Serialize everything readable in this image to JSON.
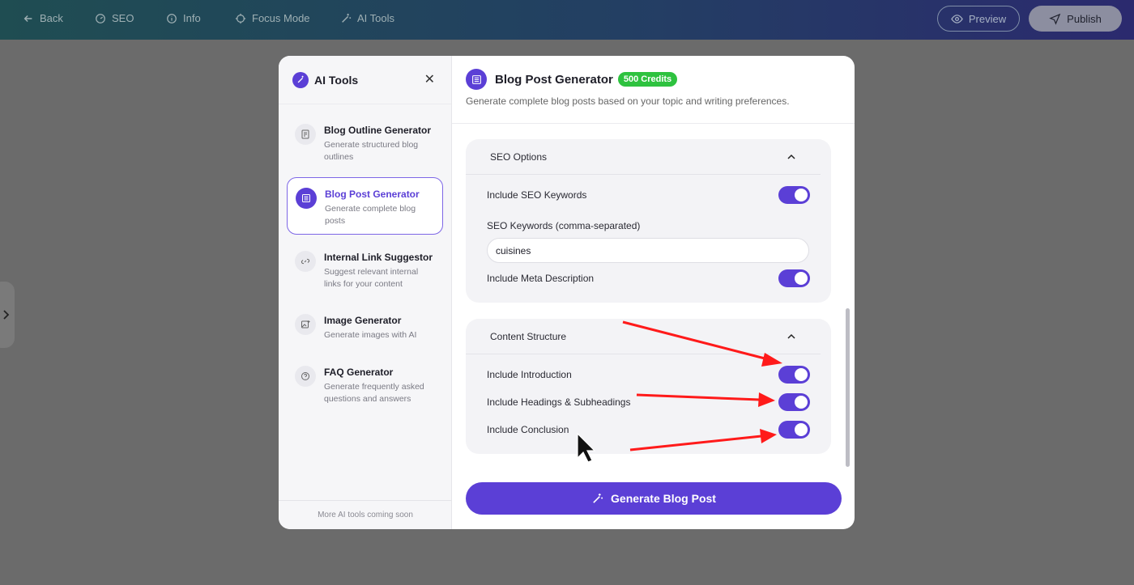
{
  "topbar": {
    "back": "Back",
    "seo": "SEO",
    "info": "Info",
    "focus": "Focus Mode",
    "ai_tools": "AI Tools",
    "preview": "Preview",
    "publish": "Publish"
  },
  "sidebar": {
    "title": "AI Tools",
    "tools": [
      {
        "name": "Blog Outline Generator",
        "desc": "Generate structured blog outlines",
        "icon": "document-icon"
      },
      {
        "name": "Blog Post Generator",
        "desc": "Generate complete blog posts",
        "icon": "article-icon"
      },
      {
        "name": "Internal Link Suggestor",
        "desc": "Suggest relevant internal links for your content",
        "icon": "link-icon"
      },
      {
        "name": "Image Generator",
        "desc": "Generate images with AI",
        "icon": "image-icon"
      },
      {
        "name": "FAQ Generator",
        "desc": "Generate frequently asked questions and answers",
        "icon": "question-icon"
      }
    ],
    "footer": "More AI tools coming soon"
  },
  "panel": {
    "title": "Blog Post Generator",
    "credits": "500 Credits",
    "subtitle": "Generate complete blog posts based on your topic and writing preferences.",
    "seo": {
      "title": "SEO Options",
      "include_keywords": "Include SEO Keywords",
      "keywords_label": "SEO Keywords (comma-separated)",
      "keywords_value": "cuisines",
      "include_meta": "Include Meta Description"
    },
    "structure": {
      "title": "Content Structure",
      "intro": "Include Introduction",
      "headings": "Include Headings & Subheadings",
      "conclusion": "Include Conclusion"
    },
    "generate": "Generate Blog Post"
  },
  "colors": {
    "accent": "#5b3fd6",
    "credits_badge": "#2ec23f",
    "annotation_arrow": "#ff1a1a"
  }
}
